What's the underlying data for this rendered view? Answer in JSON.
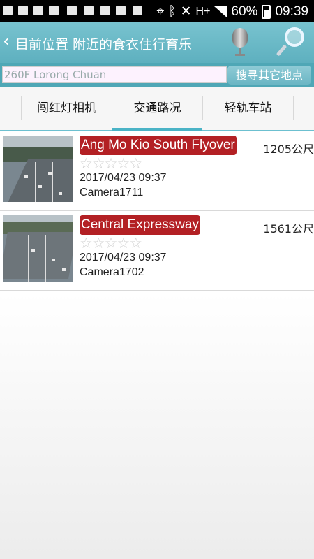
{
  "status_bar": {
    "battery": "60%",
    "time": "09:39",
    "network": "H+"
  },
  "header": {
    "back_symbol": "‹",
    "title": "目前位置 附近的食衣住行育乐"
  },
  "search": {
    "placeholder": "260F Lorong Chuan",
    "button_label": "搜寻其它地点"
  },
  "tabs": [
    {
      "label": "闯红灯相机",
      "active": false
    },
    {
      "label": "交通路况",
      "active": true
    },
    {
      "label": "轻轨车站",
      "active": false
    }
  ],
  "items": [
    {
      "name": "Ang Mo Kio South Flyover",
      "distance": "1205公尺",
      "stars": "☆☆☆☆☆",
      "rating": 0,
      "timestamp": "2017/04/23 09:37",
      "camera": "Camera1711"
    },
    {
      "name": "Central Expressway",
      "distance": "1561公尺",
      "stars": "☆☆☆☆☆",
      "rating": 0,
      "timestamp": "2017/04/23 09:37",
      "camera": "Camera1702"
    }
  ],
  "icons": {
    "microphone": "microphone-icon",
    "search": "magnifier-icon"
  },
  "colors": {
    "header": "#5eb0bf",
    "badge": "#b32024",
    "tab_indicator": "#4ab3c6"
  }
}
